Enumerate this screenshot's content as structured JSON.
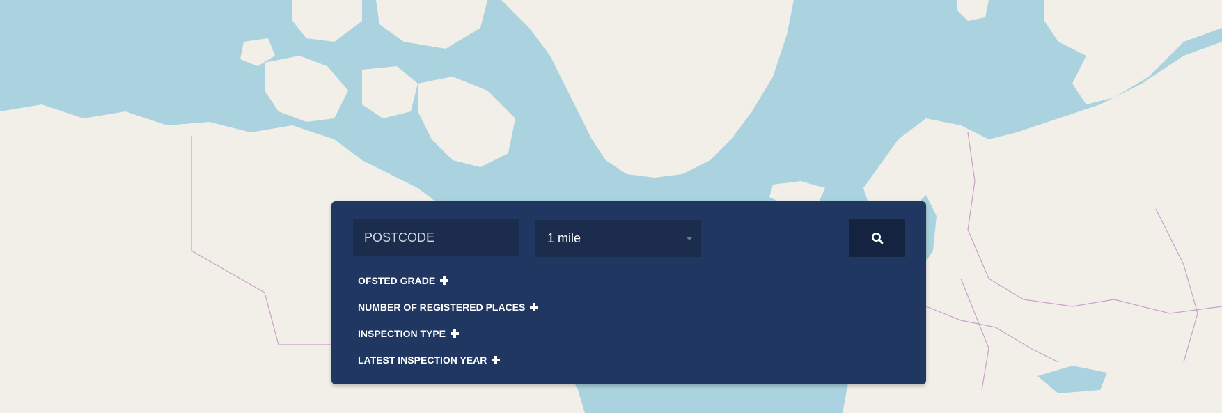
{
  "search": {
    "postcode_placeholder": "POSTCODE",
    "postcode_value": "",
    "distance_selected": "1 mile",
    "search_icon": "search-icon"
  },
  "filters": [
    {
      "label": "OFSTED GRADE",
      "icon": "plus-icon"
    },
    {
      "label": "NUMBER OF REGISTERED PLACES",
      "icon": "plus-icon"
    },
    {
      "label": "INSPECTION TYPE",
      "icon": "plus-icon"
    },
    {
      "label": "LATEST INSPECTION YEAR",
      "icon": "plus-icon"
    }
  ],
  "colors": {
    "panel": "#203762",
    "input_bg": "#1b2c4d",
    "button_bg": "#132340",
    "water": "#aad3df",
    "land": "#f2efe9",
    "border": "#c9a0c9"
  }
}
